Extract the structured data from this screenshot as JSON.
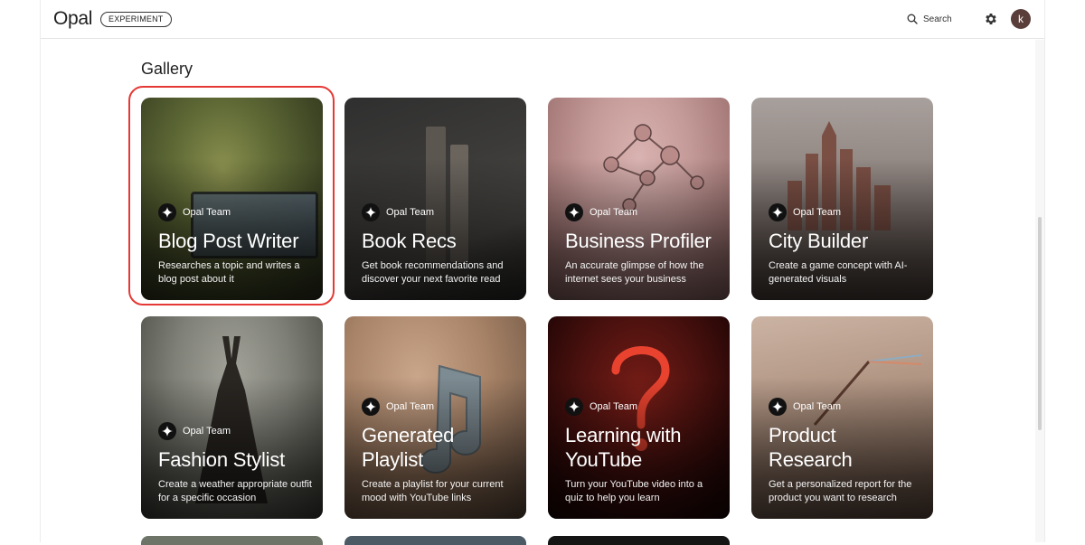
{
  "header": {
    "logo": "Opal",
    "badge": "EXPERIMENT",
    "search_label": "Search",
    "settings_icon": "gear-icon",
    "avatar_initial": "k"
  },
  "gallery": {
    "title": "Gallery",
    "cards": [
      {
        "author": "Opal Team",
        "title": "Blog Post Writer",
        "description": "Researches a topic and writes a blog post about it",
        "selected": true
      },
      {
        "author": "Opal Team",
        "title": "Book Recs",
        "description": "Get book recommendations and discover your next favorite read"
      },
      {
        "author": "Opal Team",
        "title": "Business Profiler",
        "description": "An accurate glimpse of how the internet sees your business"
      },
      {
        "author": "Opal Team",
        "title": "City Builder",
        "description": "Create a game concept with AI-generated visuals"
      },
      {
        "author": "Opal Team",
        "title": "Fashion Stylist",
        "description": "Create a weather appropriate outfit for a specific occasion"
      },
      {
        "author": "Opal Team",
        "title": "Generated Playlist",
        "description": "Create a playlist for your current mood with YouTube links"
      },
      {
        "author": "Opal Team",
        "title": "Learning with YouTube",
        "description": "Turn your YouTube video into a quiz to help you learn"
      },
      {
        "author": "Opal Team",
        "title": "Product Research",
        "description": "Get a personalized report for the product you want to research"
      }
    ]
  },
  "colors": {
    "highlight": "#e53935",
    "avatar": "#5a3e3a"
  }
}
